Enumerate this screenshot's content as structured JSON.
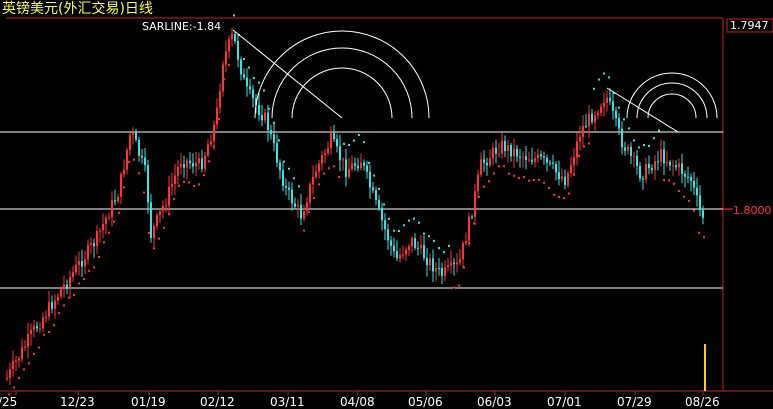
{
  "title": "英镑美元(外汇交易)日线",
  "indicator_label": "SARLINE:-1.84",
  "colors": {
    "background": "#000000",
    "title": "#ffff33",
    "up_candle": "#ff3333",
    "down_candle": "#33e6e6",
    "sar_below": "#ff3333",
    "sar_above": "#33e6e6",
    "guides": "#ffffff",
    "axis": "#cc2222",
    "axis_text": "#ffffff",
    "price_text": "#ffffff",
    "price_ref": "#ff3333",
    "volume_bar": "#ffcc00",
    "arcs": "#ffffff",
    "trendlines": "#ffffff"
  },
  "chart_data": {
    "type": "candlestick",
    "title": "英镑美元(外汇交易)日线",
    "indicator": {
      "name": "SARLINE",
      "value": "-1.84"
    },
    "y_labels": [
      "1.7947",
      "1.8000"
    ],
    "x_labels": [
      "/25",
      "12/23",
      "01/19",
      "02/12",
      "03/11",
      "04/08",
      "05/06",
      "06/03",
      "07/01",
      "07/29",
      "08/26"
    ],
    "horizontal_guides": 3,
    "annotations": [
      "two fan-arc groups",
      "two trendlines"
    ]
  }
}
